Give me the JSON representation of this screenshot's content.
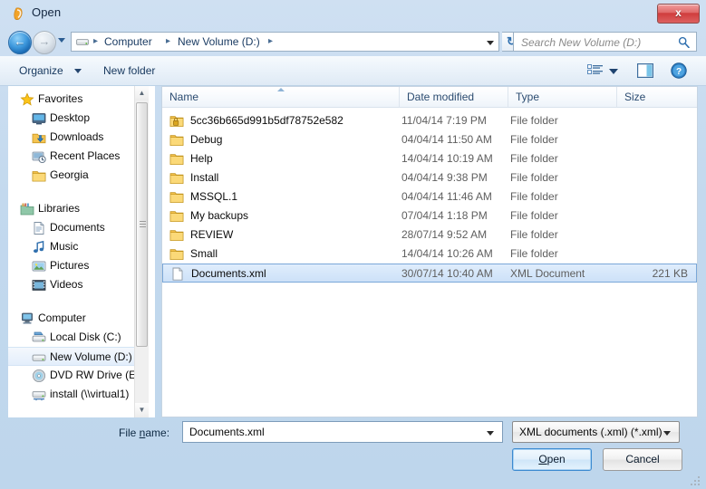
{
  "window": {
    "title": "Open",
    "title_icon": "app-icon",
    "close_label": "x"
  },
  "nav": {
    "back_glyph": "←",
    "forward_glyph": "→",
    "breadcrumbs": [
      "Computer",
      "New Volume (D:)"
    ],
    "separator": "▸",
    "refresh_glyph": "↻",
    "drive_icon": "drive-icon"
  },
  "search": {
    "placeholder": "Search New Volume (D:)",
    "icon": "search-icon"
  },
  "toolbar": {
    "organize_label": "Organize",
    "new_folder_label": "New folder",
    "viewmode_icon": "list-view-icon",
    "preview_pane_icon": "preview-pane-icon",
    "help_icon": "help-icon",
    "help_glyph": "?"
  },
  "sidebar": {
    "groups": [
      {
        "label": "Favorites",
        "icon": "star-icon",
        "items": [
          {
            "label": "Desktop",
            "icon": "desktop-icon"
          },
          {
            "label": "Downloads",
            "icon": "downloads-icon"
          },
          {
            "label": "Recent Places",
            "icon": "recent-places-icon"
          },
          {
            "label": "Georgia",
            "icon": "folder-icon"
          }
        ]
      },
      {
        "label": "Libraries",
        "icon": "libraries-icon",
        "items": [
          {
            "label": "Documents",
            "icon": "document-icon"
          },
          {
            "label": "Music",
            "icon": "music-icon"
          },
          {
            "label": "Pictures",
            "icon": "pictures-icon"
          },
          {
            "label": "Videos",
            "icon": "videos-icon"
          }
        ]
      },
      {
        "label": "Computer",
        "icon": "computer-icon",
        "items": [
          {
            "label": "Local Disk (C:)",
            "icon": "local-disk-icon",
            "selected": false
          },
          {
            "label": "New Volume (D:)",
            "icon": "drive-icon",
            "selected": true
          },
          {
            "label": "DVD RW Drive (E:",
            "icon": "dvd-drive-icon",
            "selected": false
          },
          {
            "label": "install (\\\\virtual1)",
            "icon": "network-drive-icon",
            "selected": false
          }
        ]
      }
    ],
    "scroll_up_glyph": "▲",
    "scroll_down_glyph": "▼"
  },
  "filelist": {
    "columns": [
      {
        "label": "Name",
        "sorted": true
      },
      {
        "label": "Date modified",
        "sorted": false
      },
      {
        "label": "Type",
        "sorted": false
      },
      {
        "label": "Size",
        "sorted": false
      }
    ],
    "rows": [
      {
        "name": "5cc36b665d991b5df78752e582",
        "date": "11/04/14 7:19 PM",
        "type": "File folder",
        "size": "",
        "icon": "secured-folder-icon",
        "selected": false
      },
      {
        "name": "Debug",
        "date": "04/04/14 11:50 AM",
        "type": "File folder",
        "size": "",
        "icon": "folder-icon",
        "selected": false
      },
      {
        "name": "Help",
        "date": "14/04/14 10:19 AM",
        "type": "File folder",
        "size": "",
        "icon": "folder-icon",
        "selected": false
      },
      {
        "name": "Install",
        "date": "04/04/14 9:38 PM",
        "type": "File folder",
        "size": "",
        "icon": "folder-icon",
        "selected": false
      },
      {
        "name": "MSSQL.1",
        "date": "04/04/14 11:46 AM",
        "type": "File folder",
        "size": "",
        "icon": "folder-icon",
        "selected": false
      },
      {
        "name": "My backups",
        "date": "07/04/14 1:18 PM",
        "type": "File folder",
        "size": "",
        "icon": "folder-icon",
        "selected": false
      },
      {
        "name": "REVIEW",
        "date": "28/07/14 9:52 AM",
        "type": "File folder",
        "size": "",
        "icon": "folder-icon",
        "selected": false
      },
      {
        "name": "Small",
        "date": "14/04/14 10:26 AM",
        "type": "File folder",
        "size": "",
        "icon": "folder-icon",
        "selected": false
      },
      {
        "name": "Documents.xml",
        "date": "30/07/14 10:40 AM",
        "type": "XML Document",
        "size": "221 KB",
        "icon": "xml-file-icon",
        "selected": true
      }
    ]
  },
  "footer": {
    "filename_label_pre": "File ",
    "filename_label_accel": "n",
    "filename_label_post": "ame:",
    "filename_value": "Documents.xml",
    "filter_value": "XML documents (.xml) (*.xml)",
    "open_pre": "",
    "open_accel": "O",
    "open_post": "pen",
    "cancel_label": "Cancel"
  },
  "colors": {
    "accent": "#3c8ad0",
    "selection": "#cde1f8",
    "frame": "#c3d9ee",
    "close": "#cf3c3c"
  }
}
